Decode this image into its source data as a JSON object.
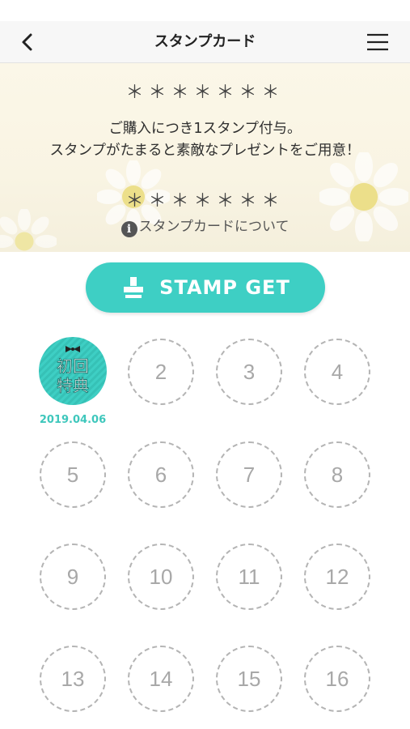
{
  "header": {
    "title": "スタンプカード",
    "back_icon": "chevron-left-icon",
    "menu_icon": "hamburger-menu-icon"
  },
  "banner": {
    "stars_top": "＊＊＊＊＊＊＊",
    "desc_line1": "ご購入につき1スタンプ付与。",
    "desc_line2": "スタンプがたまると素敵なプレゼントをご用意！",
    "stars_bottom": "＊＊＊＊＊＊＊",
    "about_link": "スタンプカードについて",
    "info_icon": "info-icon"
  },
  "stamp_button": {
    "label": "STAMP GET",
    "icon": "stamp-icon",
    "color": "#3ecfc4"
  },
  "stamps": {
    "first": {
      "text_line1": "初回",
      "text_line2": "特典",
      "date": "2019.04.06",
      "color": "#3ecfc4"
    },
    "slots": [
      "2",
      "3",
      "4",
      "5",
      "6",
      "7",
      "8",
      "9",
      "10",
      "11",
      "12",
      "13",
      "14",
      "15",
      "16"
    ]
  }
}
